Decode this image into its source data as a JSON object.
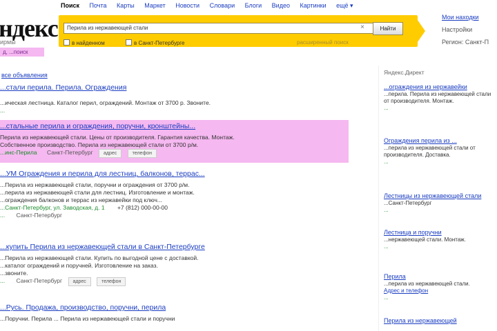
{
  "logo": {
    "text": "ндекс",
    "sub": "ирмы"
  },
  "city_pill": "д, ...поиск",
  "nav": {
    "items": [
      "Поиск",
      "Почта",
      "Карты",
      "Маркет",
      "Новости",
      "Словари",
      "Блоги",
      "Видео",
      "Картинки",
      "ещё ▾"
    ]
  },
  "search": {
    "query": "Перила из нержавеющей стали",
    "button_label": "Найти",
    "clear_icon": "×",
    "check1": "в найденном",
    "check2": "в Санкт-Петербурге",
    "advanced": "расширенный поиск"
  },
  "user": {
    "login": "Мои находки",
    "settings": "Настройки",
    "region": "Регион: Санкт-П"
  },
  "ads_label": "все объявления",
  "results": [
    {
      "title": "...стали перила. Перила. Ограждения",
      "text": "...ическая лестница. Каталог перил, ограждений. Монтаж от 3700 р. Звоните.",
      "url": "..."
    },
    {
      "title": "...стальные перила и ограждения, поручни, кронштейны...",
      "text1": "Перила из нержавеющей стали. Цены от производителя. Гарантия качества. Монтаж.",
      "text2": "Собственное производство. Перила из нержавеющей стали от 3700 р/м.",
      "url": "...инс-Перила",
      "city": "Санкт-Петербург",
      "pill1": "адрес",
      "pill2": "телефон"
    },
    {
      "title": "...УМ Ограждения и перила для лестниц, балконов, террас...",
      "text1": "...Перила из нержавеющей стали, поручни и ограждения от 3700 р/м.",
      "text2": "...перила из нержавеющей стали для лестниц. Изготовление и монтаж.",
      "text3": "...ограждения балконов и террас из нержавейки под ключ...",
      "url": "...Санкт-Петербург, ул. Заводская, д. 1",
      "url2": "...",
      "city": "Санкт-Петербург",
      "phone": "+7 (812) 000-00-00"
    },
    {
      "title": "...купить Перила из нержавеющей стали в Санкт-Петербурге",
      "text1": "...Перила из нержавеющей стали. Купить по выгодной цене с доставкой.",
      "text2": "...каталог ограждений и поручней. Изготовление на заказ.",
      "text3": "...звоните.",
      "url": "...",
      "city": "Санкт-Петербург",
      "pill1": "адрес",
      "pill2": "телефон"
    },
    {
      "title": "...Русь. Продажа, производство, поручни, перила",
      "text1": "...Поручни. Перила ... Перила из нержавеющей стали и поручни"
    }
  ],
  "right_header": "Яндекс.Директ",
  "right_ads": [
    {
      "title": "...ограждения из нержавейки",
      "text": "...перила. Перила из нержавеющей стали от производителя. Монтаж.",
      "url": "..."
    },
    {
      "title": "Ограждения перила из ...",
      "text": "...перила из нержавеющей стали от производителя. Доставка.",
      "url": "..."
    },
    {
      "title": "Лестницы из нержавеющей стали",
      "text": "...Санкт-Петербург",
      "url": "..."
    },
    {
      "title": "Лестница и поручни",
      "text": "...нержавеющей стали. Монтаж.",
      "url": "..."
    },
    {
      "title": "Перила",
      "text": "...перила из нержавеющей стали.",
      "url": "...",
      "extra": "Адрес и телефон"
    },
    {
      "title": "Перила из нержавеющей",
      "text": "",
      "url": ""
    }
  ]
}
